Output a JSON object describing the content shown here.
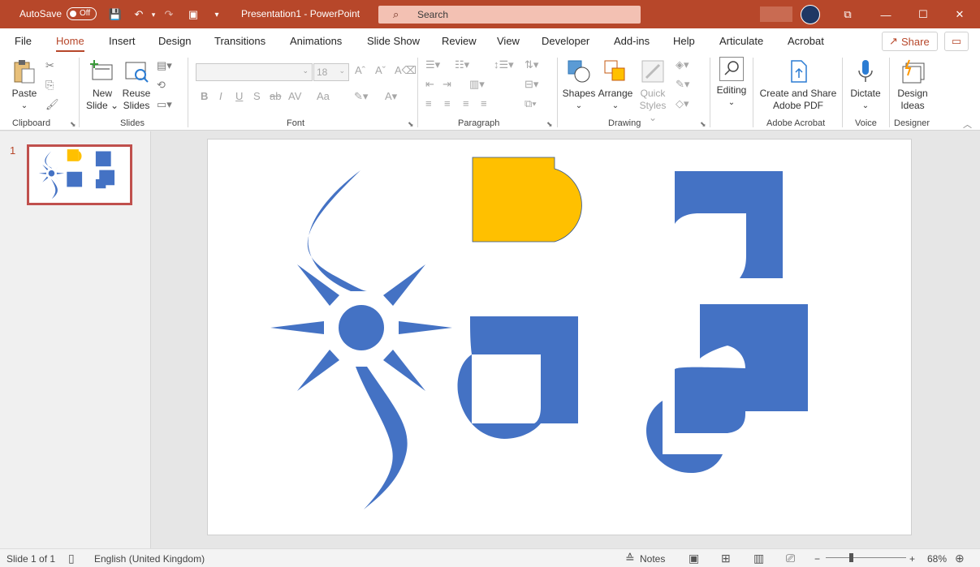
{
  "titlebar": {
    "autosave_label": "AutoSave",
    "autosave_state": "Off",
    "title": "Presentation1  -  PowerPoint",
    "search_placeholder": "Search",
    "qat": {
      "save": "💾",
      "undo": "↶",
      "redo": "↷",
      "present": "▣",
      "more": "▾"
    },
    "window": {
      "ribbon_display": "⧉",
      "minimize": "—",
      "maximize": "☐",
      "close": "✕"
    },
    "accent_color": "#b7472a"
  },
  "menu": {
    "tabs": [
      "File",
      "Home",
      "Insert",
      "Design",
      "Transitions",
      "Animations",
      "Slide Show",
      "Review",
      "View",
      "Developer",
      "Add-ins",
      "Help",
      "Articulate",
      "Acrobat"
    ],
    "active": "Home",
    "share_label": "Share",
    "share_icon": "↗",
    "comments_icon": "💬"
  },
  "ribbon": {
    "clipboard": {
      "paste": "Paste",
      "paste_arrow": "⌄",
      "group": "Clipboard"
    },
    "slides": {
      "new_slide_1": "New",
      "new_slide_2": "Slide ⌄",
      "reuse_1": "Reuse",
      "reuse_2": "Slides",
      "group": "Slides"
    },
    "font": {
      "font_size": "18",
      "bold": "B",
      "italic": "I",
      "underline": "U",
      "shadow": "S",
      "strike": "ab",
      "spacing": "AV",
      "case": "Aa",
      "group": "Font"
    },
    "paragraph": {
      "group": "Paragraph"
    },
    "drawing": {
      "shapes": "Shapes",
      "arrange": "Arrange",
      "quick_1": "Quick",
      "quick_2": "Styles ⌄",
      "group": "Drawing"
    },
    "editing": {
      "label": "Editing",
      "arrow": "⌄"
    },
    "acrobat": {
      "label_1": "Create and Share",
      "label_2": "Adobe PDF",
      "group": "Adobe Acrobat"
    },
    "voice": {
      "label": "Dictate",
      "arrow": "⌄",
      "group": "Voice"
    },
    "designer": {
      "label_1": "Design",
      "label_2": "Ideas",
      "group": "Designer"
    },
    "collapse_icon": "︿"
  },
  "thumbnails": {
    "slide_number": "1"
  },
  "slide": {
    "shape_blue": "#4472c4",
    "shape_yellow": "#ffc000",
    "shape_outline": "#2f528f"
  },
  "status": {
    "slide_info": "Slide 1 of 1",
    "language": "English (United Kingdom)",
    "notes_label": "Notes",
    "zoom": "68%",
    "zoom_minus": "−",
    "zoom_plus": "+",
    "zoom_fraction": 0.3
  }
}
